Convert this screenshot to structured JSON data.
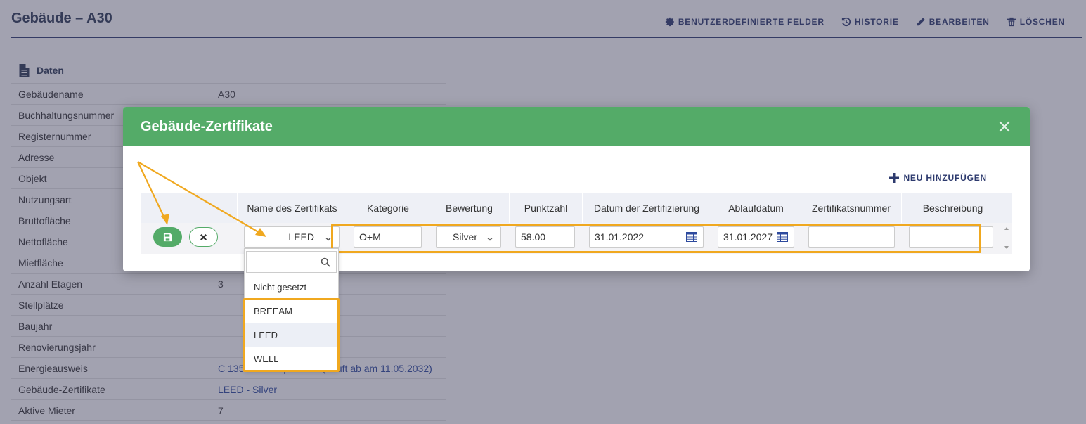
{
  "page": {
    "title": "Gebäude – A30",
    "actions": [
      {
        "label": "BENUTZERDEFINIERTE FELDER",
        "icon": "gear-icon"
      },
      {
        "label": "HISTORIE",
        "icon": "history-icon"
      },
      {
        "label": "BEARBEITEN",
        "icon": "pencil-icon"
      },
      {
        "label": "LÖSCHEN",
        "icon": "trash-icon"
      }
    ],
    "section_title": "Daten",
    "rows": [
      {
        "key": "Gebäudename",
        "value": "A30"
      },
      {
        "key": "Buchhaltungsnummer",
        "value": ""
      },
      {
        "key": "Registernummer",
        "value": ""
      },
      {
        "key": "Adresse",
        "value": ""
      },
      {
        "key": "Objekt",
        "value": ""
      },
      {
        "key": "Nutzungsart",
        "value": ""
      },
      {
        "key": "Bruttofläche",
        "value": ""
      },
      {
        "key": "Nettofläche",
        "value": ""
      },
      {
        "key": "Mietfläche",
        "value": ""
      },
      {
        "key": "Anzahl Etagen",
        "value": "3"
      },
      {
        "key": "Stellplätze",
        "value": ""
      },
      {
        "key": "Baujahr",
        "value": ""
      },
      {
        "key": "Renovierungsjahr",
        "value": ""
      },
      {
        "key": "Energieausweis",
        "value": "C 135 kWh/m² pro Jahr (Läuft ab am 11.05.2032)"
      },
      {
        "key": "Gebäude-Zertifikate",
        "value": "LEED - Silver"
      },
      {
        "key": "Aktive Mieter",
        "value": "7"
      }
    ]
  },
  "modal": {
    "title": "Gebäude-Zertifikate",
    "add_new_label": "NEU HINZUFÜGEN",
    "columns": [
      "Name des Zertifikats",
      "Kategorie",
      "Bewertung",
      "Punktzahl",
      "Datum der Zertifizierung",
      "Ablaufdatum",
      "Zertifikatsnummer",
      "Beschreibung"
    ],
    "row": {
      "name": "LEED",
      "kategorie": "O+M",
      "bewertung": "Silver",
      "punktzahl": "58.00",
      "datum": "31.01.2022",
      "ablauf": "31.01.2027",
      "nummer": "",
      "beschreibung": ""
    },
    "dropdown": {
      "search_placeholder": "",
      "options": [
        "Nicht gesetzt",
        "BREEAM",
        "LEED",
        "WELL"
      ],
      "selected": "LEED"
    }
  },
  "colors": {
    "accent_green": "#54ab68",
    "navy": "#2d3a6e",
    "highlight": "#f0a81f"
  }
}
